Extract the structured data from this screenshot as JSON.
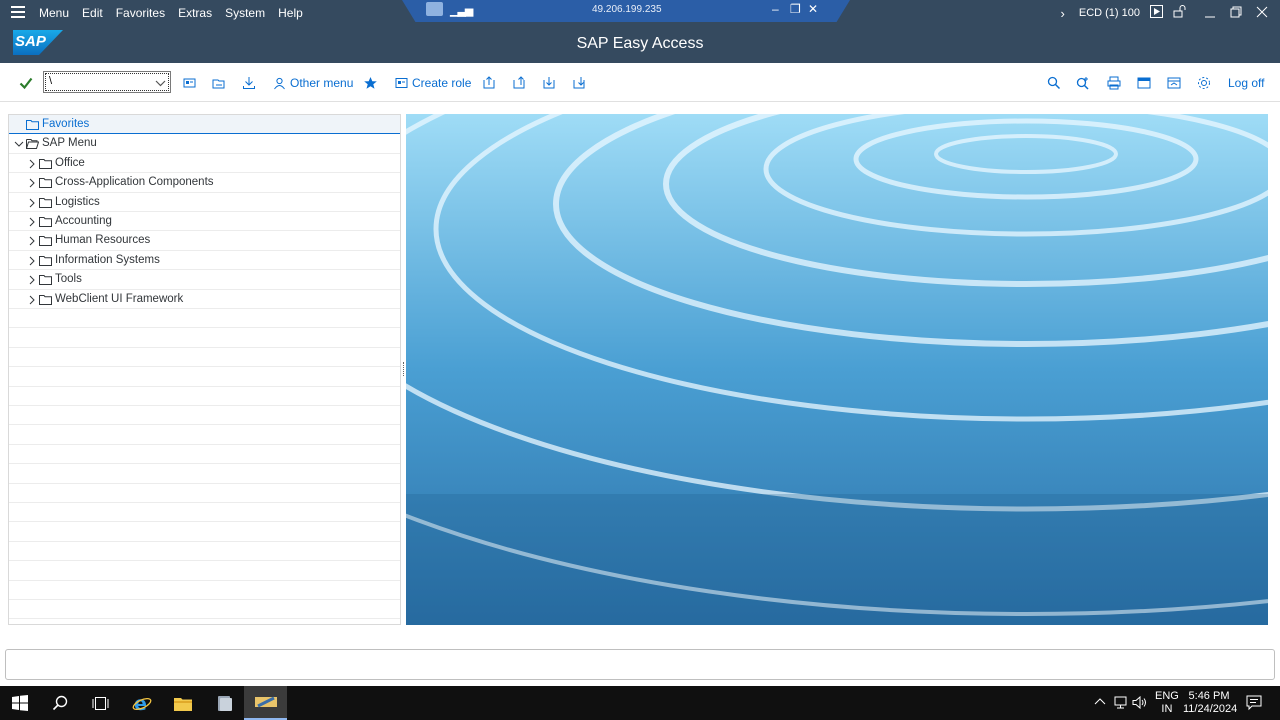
{
  "menu_bar": {
    "items": [
      "Menu",
      "Edit",
      "Favorites",
      "Extras",
      "System",
      "Help"
    ],
    "system_info": "ECD (1) 100"
  },
  "remote_session": {
    "address": "49.206.199.235"
  },
  "title": "SAP Easy Access",
  "toolbar": {
    "command_value": "\\",
    "other_menu_label": "Other menu",
    "create_role_label": "Create role",
    "log_off_label": "Log off"
  },
  "tree": {
    "favorites": "Favorites",
    "root": "SAP Menu",
    "items": [
      "Office",
      "Cross-Application Components",
      "Logistics",
      "Accounting",
      "Human Resources",
      "Information Systems",
      "Tools",
      "WebClient UI Framework"
    ]
  },
  "taskbar": {
    "lang_top": "ENG",
    "lang_bottom": "IN",
    "time": "5:46 PM",
    "date": "11/24/2024"
  },
  "colors": {
    "shell": "#354a5f",
    "accent": "#0a6ed1",
    "taskbar": "#101010"
  }
}
